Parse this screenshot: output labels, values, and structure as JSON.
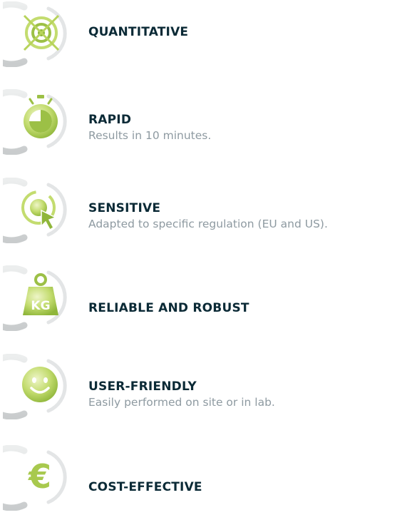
{
  "colors": {
    "title": "#0b2a36",
    "description": "#8e9aa1",
    "icon_green_light": "#dde9a0",
    "icon_green_mid": "#b7d35b",
    "icon_green_dark": "#8fb63a",
    "icon_ring": "#d7d9da"
  },
  "features": [
    {
      "icon": "target-icon",
      "title": "QUANTITATIVE",
      "description": ""
    },
    {
      "icon": "stopwatch-icon",
      "title": "RAPID",
      "description": "Results in 10 minutes."
    },
    {
      "icon": "cursor-target-icon",
      "title": "SENSITIVE",
      "description": "Adapted to specific regulation (EU and US)."
    },
    {
      "icon": "kg-weight-icon",
      "title": "RELIABLE AND ROBUST",
      "description": ""
    },
    {
      "icon": "smiley-icon",
      "title": "USER-FRIENDLY",
      "description": "Easily performed on site or in lab."
    },
    {
      "icon": "euro-icon",
      "title": "COST-EFFECTIVE",
      "description": ""
    }
  ],
  "kg_label": "KG",
  "euro_glyph": "€"
}
